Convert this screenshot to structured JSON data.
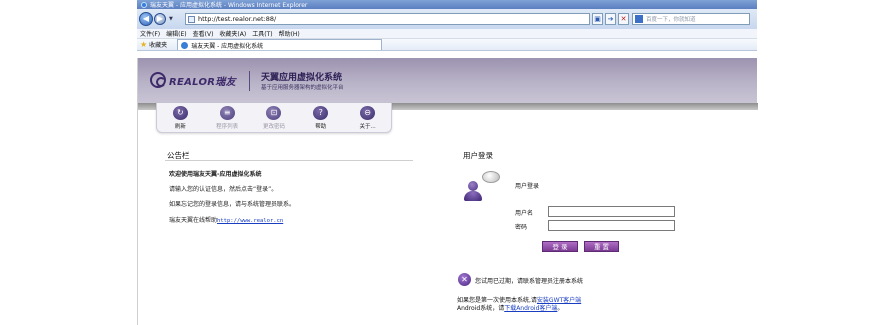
{
  "browser": {
    "window_title": "瑞友天翼 - 应用虚拟化系统 - Windows Internet Explorer",
    "back_glyph": "◀",
    "forward_glyph": "▶",
    "url": "http://test.realor.net:88/",
    "search_placeholder": "百度一下，你就知道",
    "menu": [
      "文件(F)",
      "编辑(E)",
      "查看(V)",
      "收藏夹(A)",
      "工具(T)",
      "帮助(H)"
    ],
    "favorites_label": "收藏夹",
    "tab_title": "瑞友天翼 - 应用虚拟化系统"
  },
  "header": {
    "logo_text": "REALOR瑞友",
    "product_title": "天翼应用虚拟化系统",
    "product_subtitle": "基于应用服务器架构的虚拟化平台"
  },
  "toolbar": {
    "items": [
      {
        "label": "刷新",
        "icon": "refresh-icon",
        "glyph": "↻",
        "enabled": true
      },
      {
        "label": "程序列表",
        "icon": "list-icon",
        "glyph": "≡",
        "enabled": false
      },
      {
        "label": "更改密码",
        "icon": "lock-icon",
        "glyph": "⊡",
        "enabled": false
      },
      {
        "label": "帮助",
        "icon": "help-icon",
        "glyph": "?",
        "enabled": true
      },
      {
        "label": "关于...",
        "icon": "about-icon",
        "glyph": "⊖",
        "enabled": true
      }
    ]
  },
  "notice": {
    "title": "公告栏",
    "welcome": "欢迎使用瑞友天翼-应用虚拟化系统",
    "line1": "请输入您的认证信息，然后点击“登录”。",
    "line2": "如果忘记您的登录信息，请与系统管理员联系。",
    "line3_prefix": "瑞友天翼在线帮助",
    "help_link": "http://www.realor.cn"
  },
  "login": {
    "title": "用户登录",
    "subtitle": "用户登录",
    "username_label": "用户名",
    "password_label": "密码",
    "username_value": "",
    "password_value": "",
    "login_button": "登 录",
    "reset_button": "重 置",
    "expired_text": "您试用已过期，请联系管理员注册本系统",
    "footer_line1_prefix": "如果您是第一次使用本系统,请",
    "footer_line1_link": "安装GWT客户端",
    "footer_line2_prefix": "Android系统，请",
    "footer_line2_link": "下载Android客户端",
    "footer_line2_suffix": "。"
  },
  "colors": {
    "header_purple": "#9c93b0",
    "brand_dark": "#3d2a6b",
    "button_purple": "#8e4aa8",
    "link_blue": "#1a3ec2"
  }
}
